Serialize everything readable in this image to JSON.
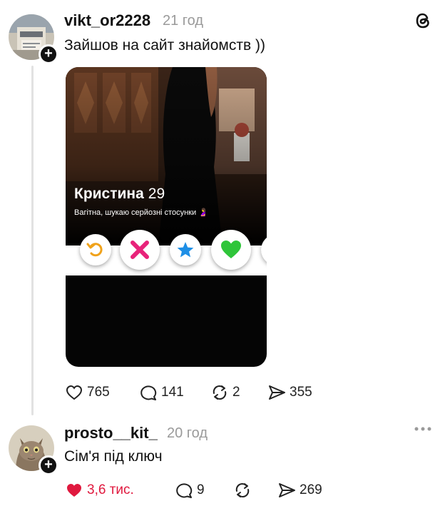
{
  "post": {
    "username": "vikt_or2228",
    "time": "21 год",
    "text": "Зайшов на сайт знайомств ))",
    "card": {
      "name": "Кристина",
      "age": "29",
      "bio": "Вагітна, шукаю серйозні стосунки 🤰"
    },
    "actions": {
      "likes": "765",
      "comments": "141",
      "reposts": "2",
      "shares": "355"
    }
  },
  "reply": {
    "username": "prosto__kit_",
    "time": "20 год",
    "text": "Сім'я під ключ",
    "actions": {
      "likes": "3,6 тис.",
      "comments": "9",
      "shares": "269"
    }
  },
  "icons": {
    "app_logo": "threads-logo-icon",
    "follow": "plus-icon",
    "like": "heart-icon",
    "comment": "comment-bubble-icon",
    "repost": "repost-icon",
    "share": "send-icon",
    "more": "more-dots-icon",
    "rewind": "rewind-icon",
    "nope": "x-icon",
    "superlike": "star-icon",
    "likecard": "green-heart-icon"
  },
  "colors": {
    "like_red": "#e0193e",
    "nope_pink": "#e8237a",
    "star_blue": "#1e8fe6",
    "heart_green": "#2fc53a",
    "rewind_orange": "#f0a21a"
  }
}
